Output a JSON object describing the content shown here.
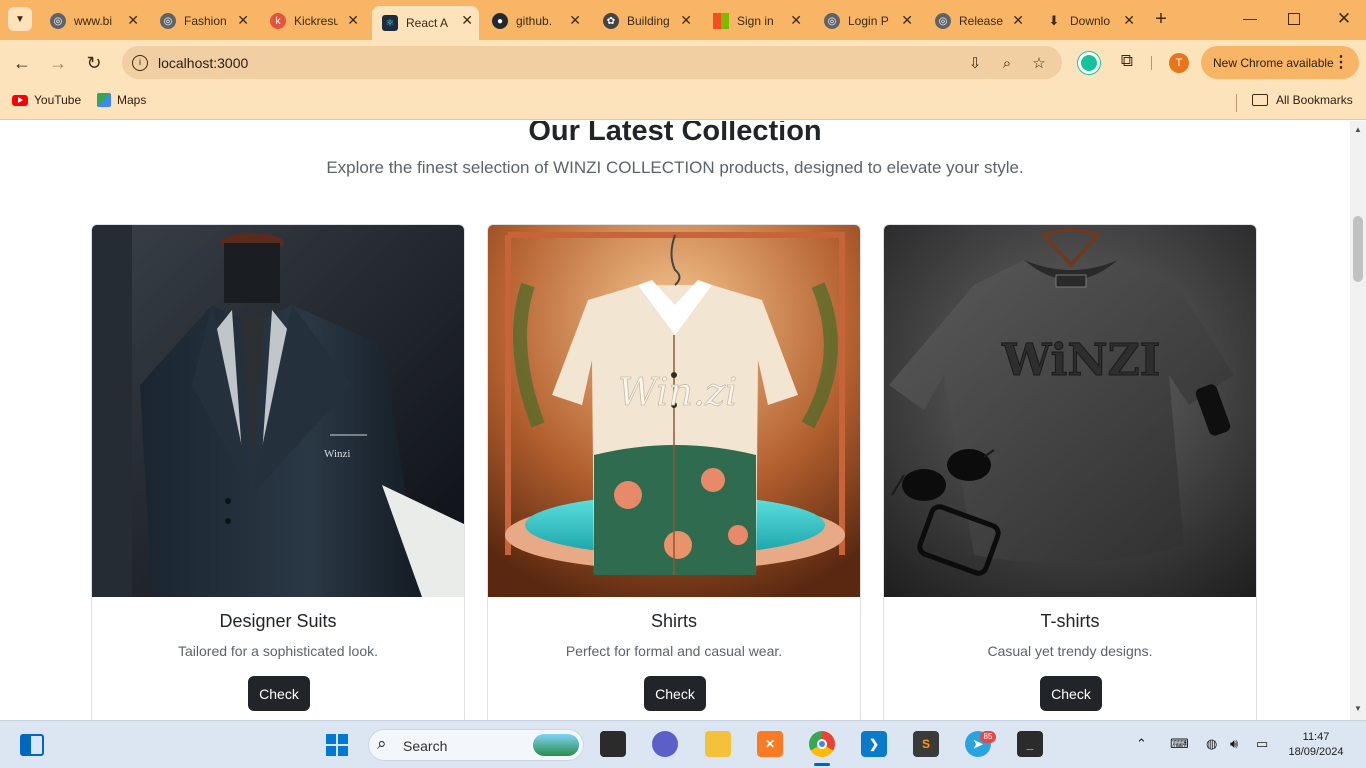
{
  "browser": {
    "tabs": [
      {
        "label": "www.bi",
        "icon": "globe-icon",
        "color": "#5f6368"
      },
      {
        "label": "Fashion",
        "icon": "globe-icon",
        "color": "#5f6368"
      },
      {
        "label": "Kickresu",
        "icon": "kickresume-icon",
        "color": "#e5533d"
      },
      {
        "label": "React A",
        "icon": "react-icon",
        "color": "#1c2c3c"
      },
      {
        "label": "github.",
        "icon": "github-icon",
        "color": "#24292f"
      },
      {
        "label": "Building",
        "icon": "openai-icon",
        "color": "#444444"
      },
      {
        "label": "Sign in",
        "icon": "microsoft-icon",
        "color": "#f25022"
      },
      {
        "label": "Login P",
        "icon": "globe-icon",
        "color": "#5f6368"
      },
      {
        "label": "Release",
        "icon": "globe-icon",
        "color": "#5f6368"
      },
      {
        "label": "Downlo",
        "icon": "download-icon",
        "color": "#3c2a13"
      }
    ],
    "new_tab": "+",
    "url": "localhost:3000",
    "profile_initial": "T",
    "update_label": "New Chrome available",
    "bookmarks": [
      {
        "label": "YouTube",
        "icon": "youtube-icon"
      },
      {
        "label": "Maps",
        "icon": "maps-icon"
      }
    ],
    "all_bookmarks": "All Bookmarks"
  },
  "page": {
    "title": "Our Latest Collection",
    "subtitle": "Explore the finest selection of WINZI COLLECTION products, designed to elevate your style.",
    "cards": [
      {
        "title": "Designer Suits",
        "text": "Tailored for a sophisticated look.",
        "button": "Check",
        "logo": "Winzi"
      },
      {
        "title": "Shirts",
        "text": "Perfect for formal and casual wear.",
        "button": "Check",
        "logo": "Win.zi"
      },
      {
        "title": "T-shirts",
        "text": "Casual yet trendy designs.",
        "button": "Check",
        "logo": "WiNZI"
      }
    ]
  },
  "taskbar": {
    "search_placeholder": "Search",
    "telegram_badge": "85",
    "time": "11:47",
    "date": "18/09/2024"
  }
}
